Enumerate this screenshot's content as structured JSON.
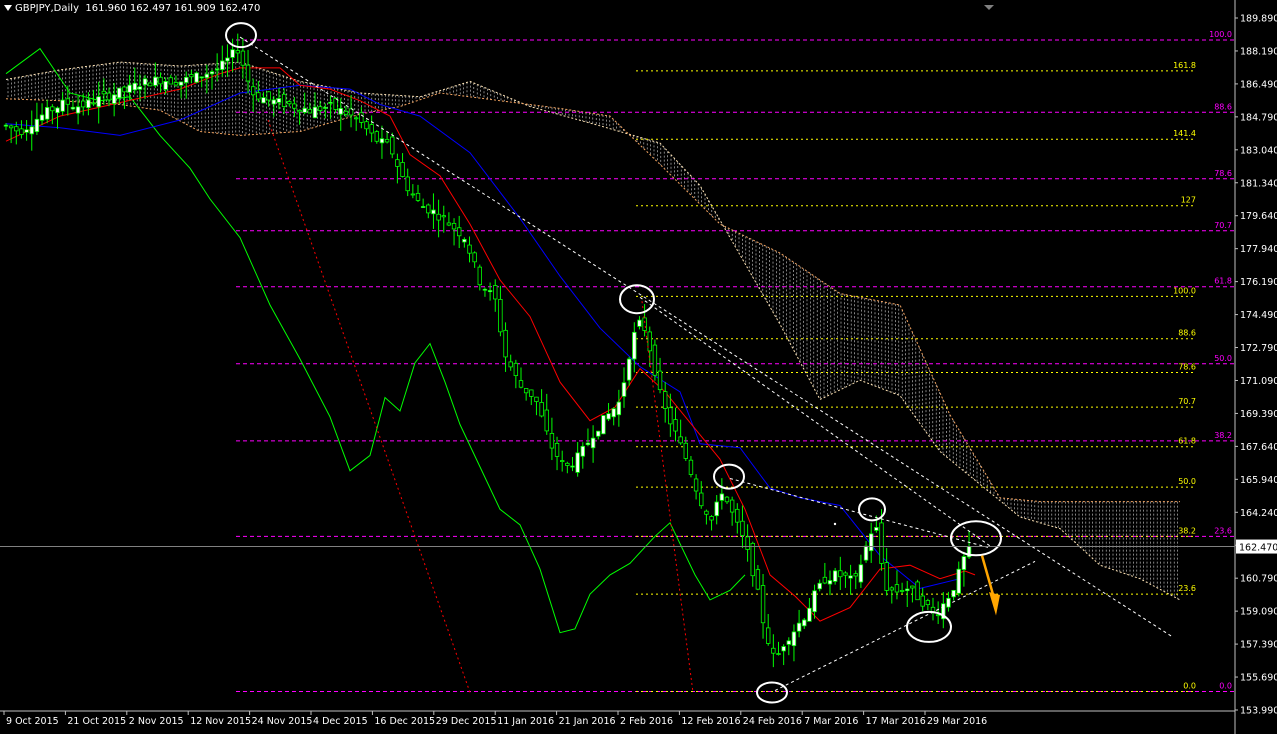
{
  "header": {
    "symbol": "GBPJPY,Daily",
    "ohlc": "161.960 162.497 161.909 162.470"
  },
  "chart_data": {
    "type": "candlestick",
    "symbol": "GBPJPY",
    "timeframe": "Daily",
    "last_price": "162.470",
    "ylim": [
      153.99,
      189.89
    ],
    "y_ticks": [
      "189.890",
      "188.190",
      "186.490",
      "184.790",
      "183.040",
      "181.340",
      "179.640",
      "177.940",
      "176.190",
      "174.490",
      "172.790",
      "171.090",
      "169.390",
      "167.640",
      "165.940",
      "164.240",
      "162.540",
      "160.790",
      "159.090",
      "157.390",
      "155.690",
      "153.990"
    ],
    "x_ticks": [
      "9 Oct 2015",
      "21 Oct 2015",
      "2 Nov 2015",
      "12 Nov 2015",
      "24 Nov 2015",
      "4 Dec 2015",
      "16 Dec 2015",
      "29 Dec 2015",
      "11 Jan 2016",
      "21 Jan 2016",
      "2 Feb 2016",
      "12 Feb 2016",
      "24 Feb 2016",
      "7 Mar 2016",
      "17 Mar 2016",
      "29 Mar 2016"
    ],
    "fib_retracement_magenta": [
      {
        "label": "100.0",
        "price": 188.75
      },
      {
        "label": "88.6",
        "price": 185.0
      },
      {
        "label": "78.6",
        "price": 181.55
      },
      {
        "label": "70.7",
        "price": 178.85
      },
      {
        "label": "61.8",
        "price": 175.95
      },
      {
        "label": "50.0",
        "price": 171.95
      },
      {
        "label": "38.2",
        "price": 167.95
      },
      {
        "label": "23.6",
        "price": 163.0
      },
      {
        "label": "0.0",
        "price": 154.95
      }
    ],
    "fib_extension_yellow": [
      {
        "label": "161.8",
        "price": 187.15
      },
      {
        "label": "141.4",
        "price": 183.6
      },
      {
        "label": "127",
        "price": 180.15
      },
      {
        "label": "100.0",
        "price": 175.45
      },
      {
        "label": "88.6",
        "price": 173.25
      },
      {
        "label": "78.6",
        "price": 171.5
      },
      {
        "label": "70.7",
        "price": 169.7
      },
      {
        "label": "61.8",
        "price": 167.65
      },
      {
        "label": "50.0",
        "price": 165.55
      },
      {
        "label": "38.2",
        "price": 163.0
      },
      {
        "label": "23.6",
        "price": 160.0
      },
      {
        "label": "0.0",
        "price": 154.95
      }
    ],
    "colors": {
      "background": "#000000",
      "bull_candle": "#ffffff",
      "bear_candle": "#000000",
      "candle_outline": "#00ff00",
      "tenkan": "#ff0000",
      "kijun": "#0000ff",
      "chikou": "#00ff00",
      "cloud_a": "#ffe4b5",
      "cloud_b": "#f4a460",
      "fib_retracement": "#ff00ff",
      "fib_extension": "#ffff00",
      "trendline": "#ffffff",
      "highlight_circle": "#ffffff",
      "arrow": "#ffa500"
    },
    "grid": false
  }
}
